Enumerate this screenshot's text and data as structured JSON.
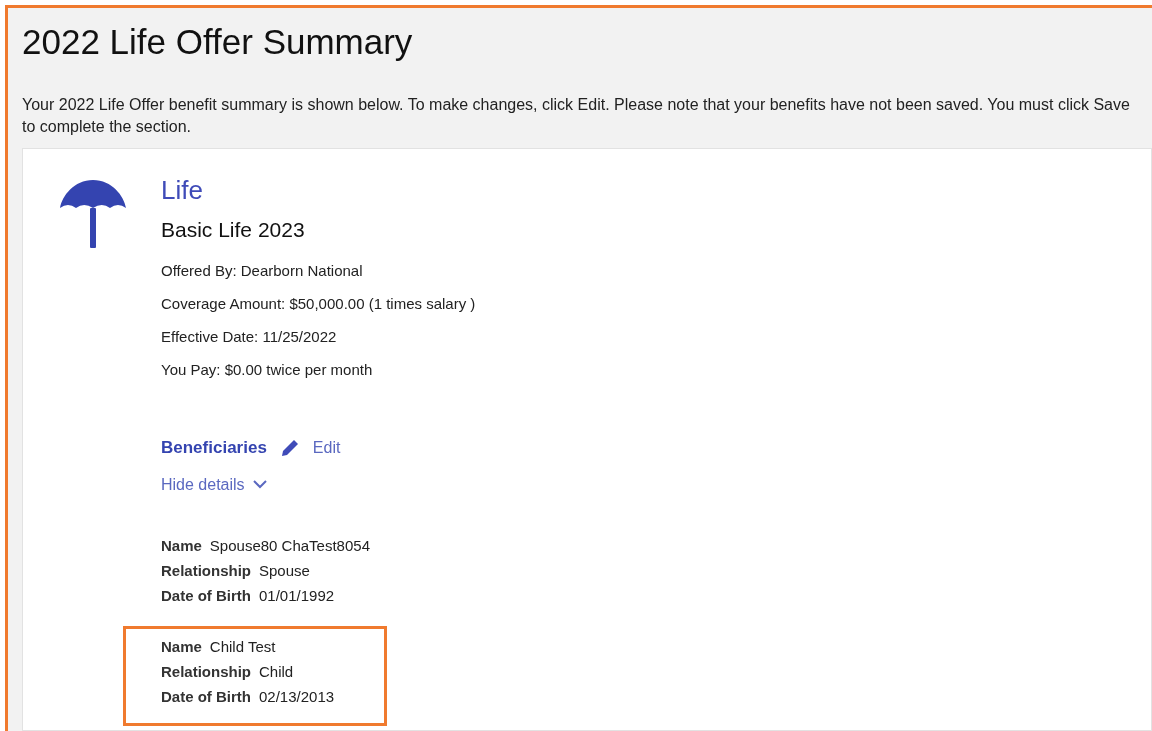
{
  "page": {
    "title": "2022 Life Offer Summary",
    "intro": "Your 2022 Life Offer benefit summary is shown below. To make changes, click Edit. Please note that your benefits have not been saved. You must click Save to complete the section."
  },
  "benefit": {
    "category": "Life",
    "plan": "Basic Life 2023",
    "details": [
      "Offered By: Dearborn National",
      "Coverage Amount: $50,000.00 (1 times salary )",
      "Effective Date: 11/25/2022",
      "You Pay: $0.00 twice per month"
    ],
    "beneficiaries_title": "Beneficiaries",
    "edit_label": "Edit",
    "toggle_label": "Hide details",
    "expanded": true,
    "beneficiaries": [
      {
        "highlighted": false,
        "fields": [
          {
            "label": "Name",
            "value": "Spouse80 ChaTest8054"
          },
          {
            "label": "Relationship",
            "value": "Spouse"
          },
          {
            "label": "Date of Birth",
            "value": "01/01/1992"
          }
        ]
      },
      {
        "highlighted": true,
        "fields": [
          {
            "label": "Name",
            "value": "Child Test"
          },
          {
            "label": "Relationship",
            "value": "Child"
          },
          {
            "label": "Date of Birth",
            "value": "02/13/2013"
          }
        ]
      }
    ]
  }
}
